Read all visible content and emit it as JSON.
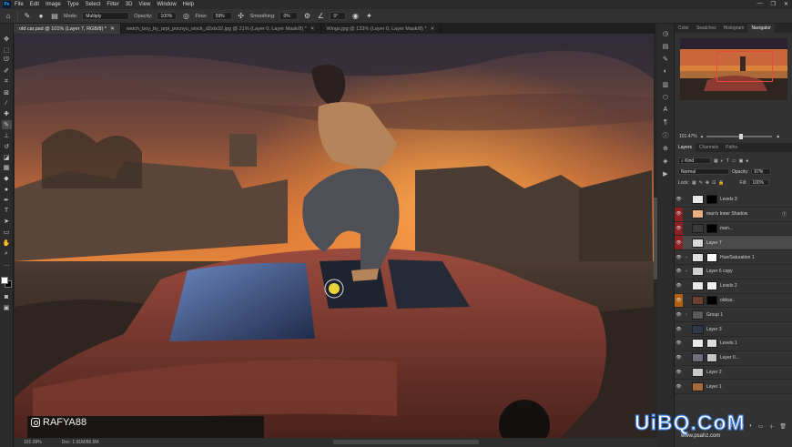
{
  "app": {
    "logo": "Ps",
    "menu": [
      "File",
      "Edit",
      "Image",
      "Type",
      "Select",
      "Filter",
      "3D",
      "View",
      "Window",
      "Help"
    ]
  },
  "options": {
    "mode_label": "Mode:",
    "mode_value": "Multiply",
    "opacity_label": "Opacity:",
    "opacity_value": "100%",
    "flow_label": "Flow:",
    "flow_value": "59%",
    "smoothing_label": "Smoothing:",
    "smoothing_value": "0%",
    "angle_value": "0°"
  },
  "tabs": [
    {
      "label": "old car.psd @ 101% (Layer 7, RGB/8) *",
      "active": true
    },
    {
      "label": "watch_boy_by_arpi_pocnyu_stock_d2xtx32.jpg @ 21% (Layer 0, Layer Mask/8) *",
      "active": false
    },
    {
      "label": "Wings.jpg @ 133% (Layer 0, Layer Mask/8) *",
      "active": false
    }
  ],
  "status": {
    "zoom": "101.09%",
    "doc": "Doc: 1.91M/86.6M"
  },
  "credit": "RAFYA88",
  "panels": {
    "top_tabs": [
      "Color",
      "Swatches",
      "Histogram",
      "Navigator"
    ],
    "nav_zoom": "101.47%",
    "layer_tabs": [
      "Layers",
      "Channels",
      "Paths"
    ],
    "kind_label": "Kind",
    "blend_mode": "Normal",
    "opacity_label": "Opacity:",
    "opacity_value": "97%",
    "lock_label": "Lock:",
    "fill_label": "Fill:",
    "fill_value": "100%"
  },
  "layers": [
    {
      "name": "Levels 3",
      "eye": "normal",
      "thumb": "#e9e9e9",
      "mask": true
    },
    {
      "name": "man's Inner Shadow",
      "eye": "red",
      "thumb": "#e7b184",
      "mask": false
    },
    {
      "name": "man...",
      "eye": "red",
      "thumb": "#3a3a3a",
      "mask": true
    },
    {
      "name": "Layer 7",
      "eye": "red",
      "thumb": "#d9d9d9",
      "mask": false,
      "selected": true
    },
    {
      "name": "Hue/Saturation 1",
      "eye": "normal",
      "thumb": "#e0e0e0",
      "mask": true
    },
    {
      "name": "Layer 6 copy",
      "eye": "normal",
      "thumb": "#cfcfcf",
      "mask": false
    },
    {
      "name": "Levels 2",
      "eye": "normal",
      "thumb": "#e9e9e9",
      "mask": true
    },
    {
      "name": "oldcar..",
      "eye": "orange",
      "thumb": "#6b4030",
      "mask": true
    },
    {
      "name": "Group 1",
      "eye": "normal",
      "thumb": "#5a5a5a",
      "mask": false
    },
    {
      "name": "Layer 3",
      "eye": "normal",
      "thumb": "#2e3a4a",
      "mask": false
    },
    {
      "name": "Levels 1",
      "eye": "normal",
      "thumb": "#e9e9e9",
      "mask": true
    },
    {
      "name": "Layer 0...",
      "eye": "normal",
      "thumb": "#6e6e7a",
      "mask": true
    },
    {
      "name": "Layer 2",
      "eye": "normal",
      "thumb": "#c9c9c9",
      "mask": false
    },
    {
      "name": "Layer 1",
      "eye": "normal",
      "thumb": "#a86a3a",
      "mask": false
    }
  ],
  "watermark": {
    "brand": "UiBQ.CoM",
    "site": "www.psahz.com"
  }
}
